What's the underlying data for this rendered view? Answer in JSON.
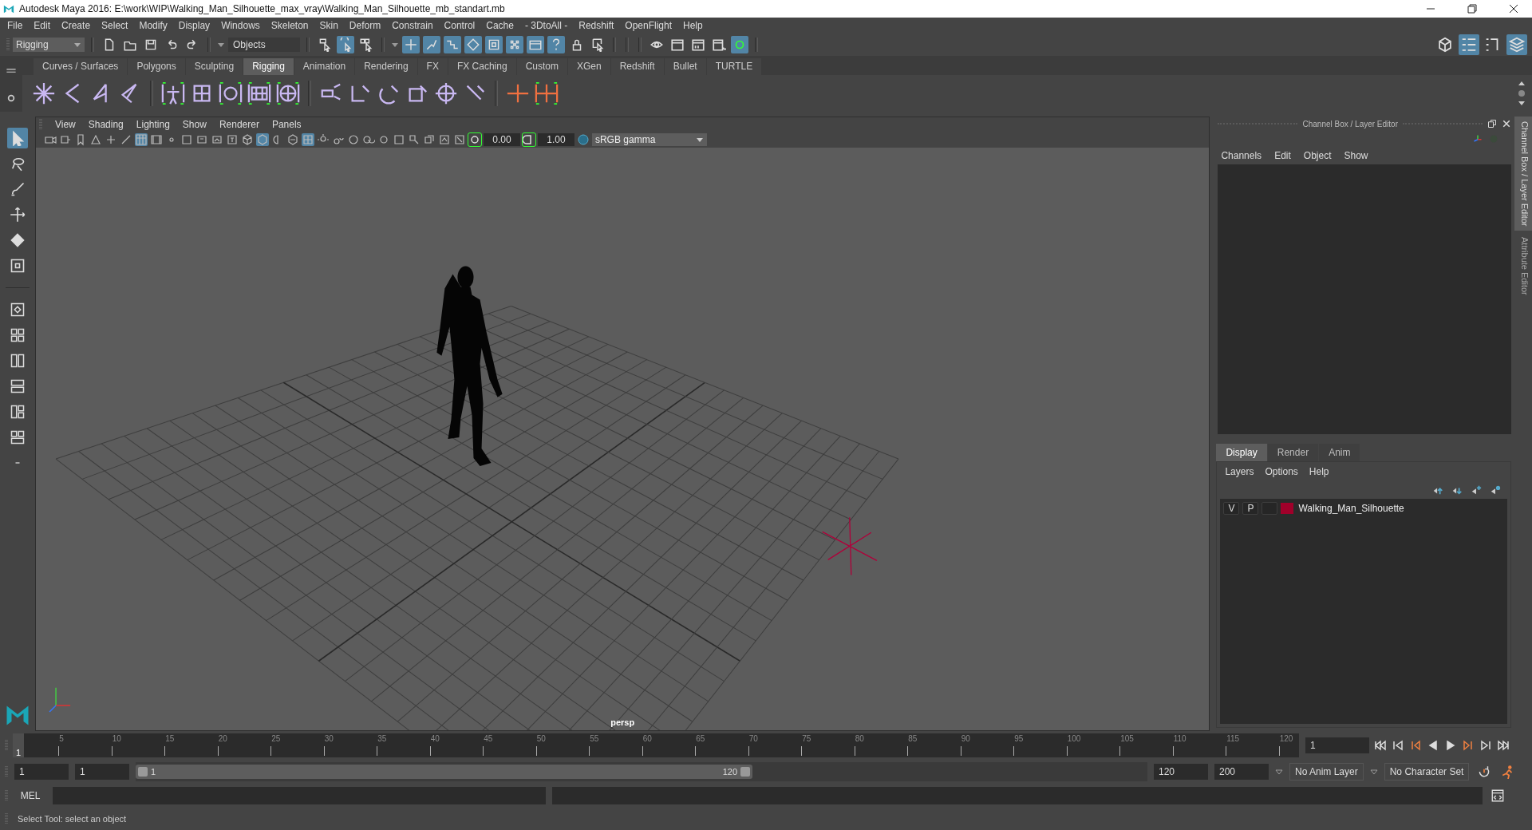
{
  "window": {
    "title": "Autodesk Maya 2016: E:\\work\\WIP\\Walking_Man_Silhouette_max_vray\\Walking_Man_Silhouette_mb_standart.mb"
  },
  "menu_bar": [
    "File",
    "Edit",
    "Create",
    "Select",
    "Modify",
    "Display",
    "Windows",
    "Skeleton",
    "Skin",
    "Deform",
    "Constrain",
    "Control",
    "Cache",
    "- 3DtoAll -",
    "Redshift",
    "OpenFlight",
    "Help"
  ],
  "status_line": {
    "menu_set": "Rigging",
    "selection_mode": "Objects"
  },
  "shelf": {
    "tabs": [
      {
        "label": "Curves / Surfaces",
        "selected": false
      },
      {
        "label": "Polygons",
        "selected": false
      },
      {
        "label": "Sculpting",
        "selected": false
      },
      {
        "label": "Rigging",
        "selected": true
      },
      {
        "label": "Animation",
        "selected": false
      },
      {
        "label": "Rendering",
        "selected": false
      },
      {
        "label": "FX",
        "selected": false
      },
      {
        "label": "FX Caching",
        "selected": false
      },
      {
        "label": "Custom",
        "selected": false
      },
      {
        "label": "XGen",
        "selected": false
      },
      {
        "label": "Redshift",
        "selected": false
      },
      {
        "label": "Bullet",
        "selected": false
      },
      {
        "label": "TURTLE",
        "selected": false
      }
    ]
  },
  "viewport": {
    "menus": [
      "View",
      "Shading",
      "Lighting",
      "Show",
      "Renderer",
      "Panels"
    ],
    "exposure": "0.00",
    "gamma": "1.00",
    "color_space": "sRGB gamma",
    "camera": "persp"
  },
  "channel_box": {
    "title": "Channel Box / Layer Editor",
    "menus": [
      "Channels",
      "Edit",
      "Object",
      "Show"
    ]
  },
  "side_tabs": [
    {
      "label": "Channel Box / Layer Editor",
      "selected": true
    },
    {
      "label": "Attribute Editor",
      "selected": false
    }
  ],
  "layer_editor": {
    "tabs": [
      {
        "label": "Display",
        "selected": true
      },
      {
        "label": "Render",
        "selected": false
      },
      {
        "label": "Anim",
        "selected": false
      }
    ],
    "menus": [
      "Layers",
      "Options",
      "Help"
    ],
    "layers": [
      {
        "visibility": "V",
        "playback": "P",
        "name": "Walking_Man_Silhouette",
        "color": "#a0002a"
      }
    ]
  },
  "time_slider": {
    "ticks": [
      "5",
      "10",
      "15",
      "20",
      "25",
      "30",
      "35",
      "40",
      "45",
      "50",
      "55",
      "60",
      "65",
      "70",
      "75",
      "80",
      "85",
      "90",
      "95",
      "100",
      "105",
      "110",
      "115",
      "120"
    ],
    "current_frame": "1",
    "level": 0,
    "frame_field": "1"
  },
  "range_slider": {
    "start": "1",
    "playback_start": "1",
    "range_start": "1",
    "range_end": "120",
    "playback_end": "120",
    "end": "200",
    "anim_layer": "No Anim Layer",
    "character_set": "No Character Set"
  },
  "command_line": {
    "label": "MEL"
  },
  "help_line": "Select Tool: select an object"
}
